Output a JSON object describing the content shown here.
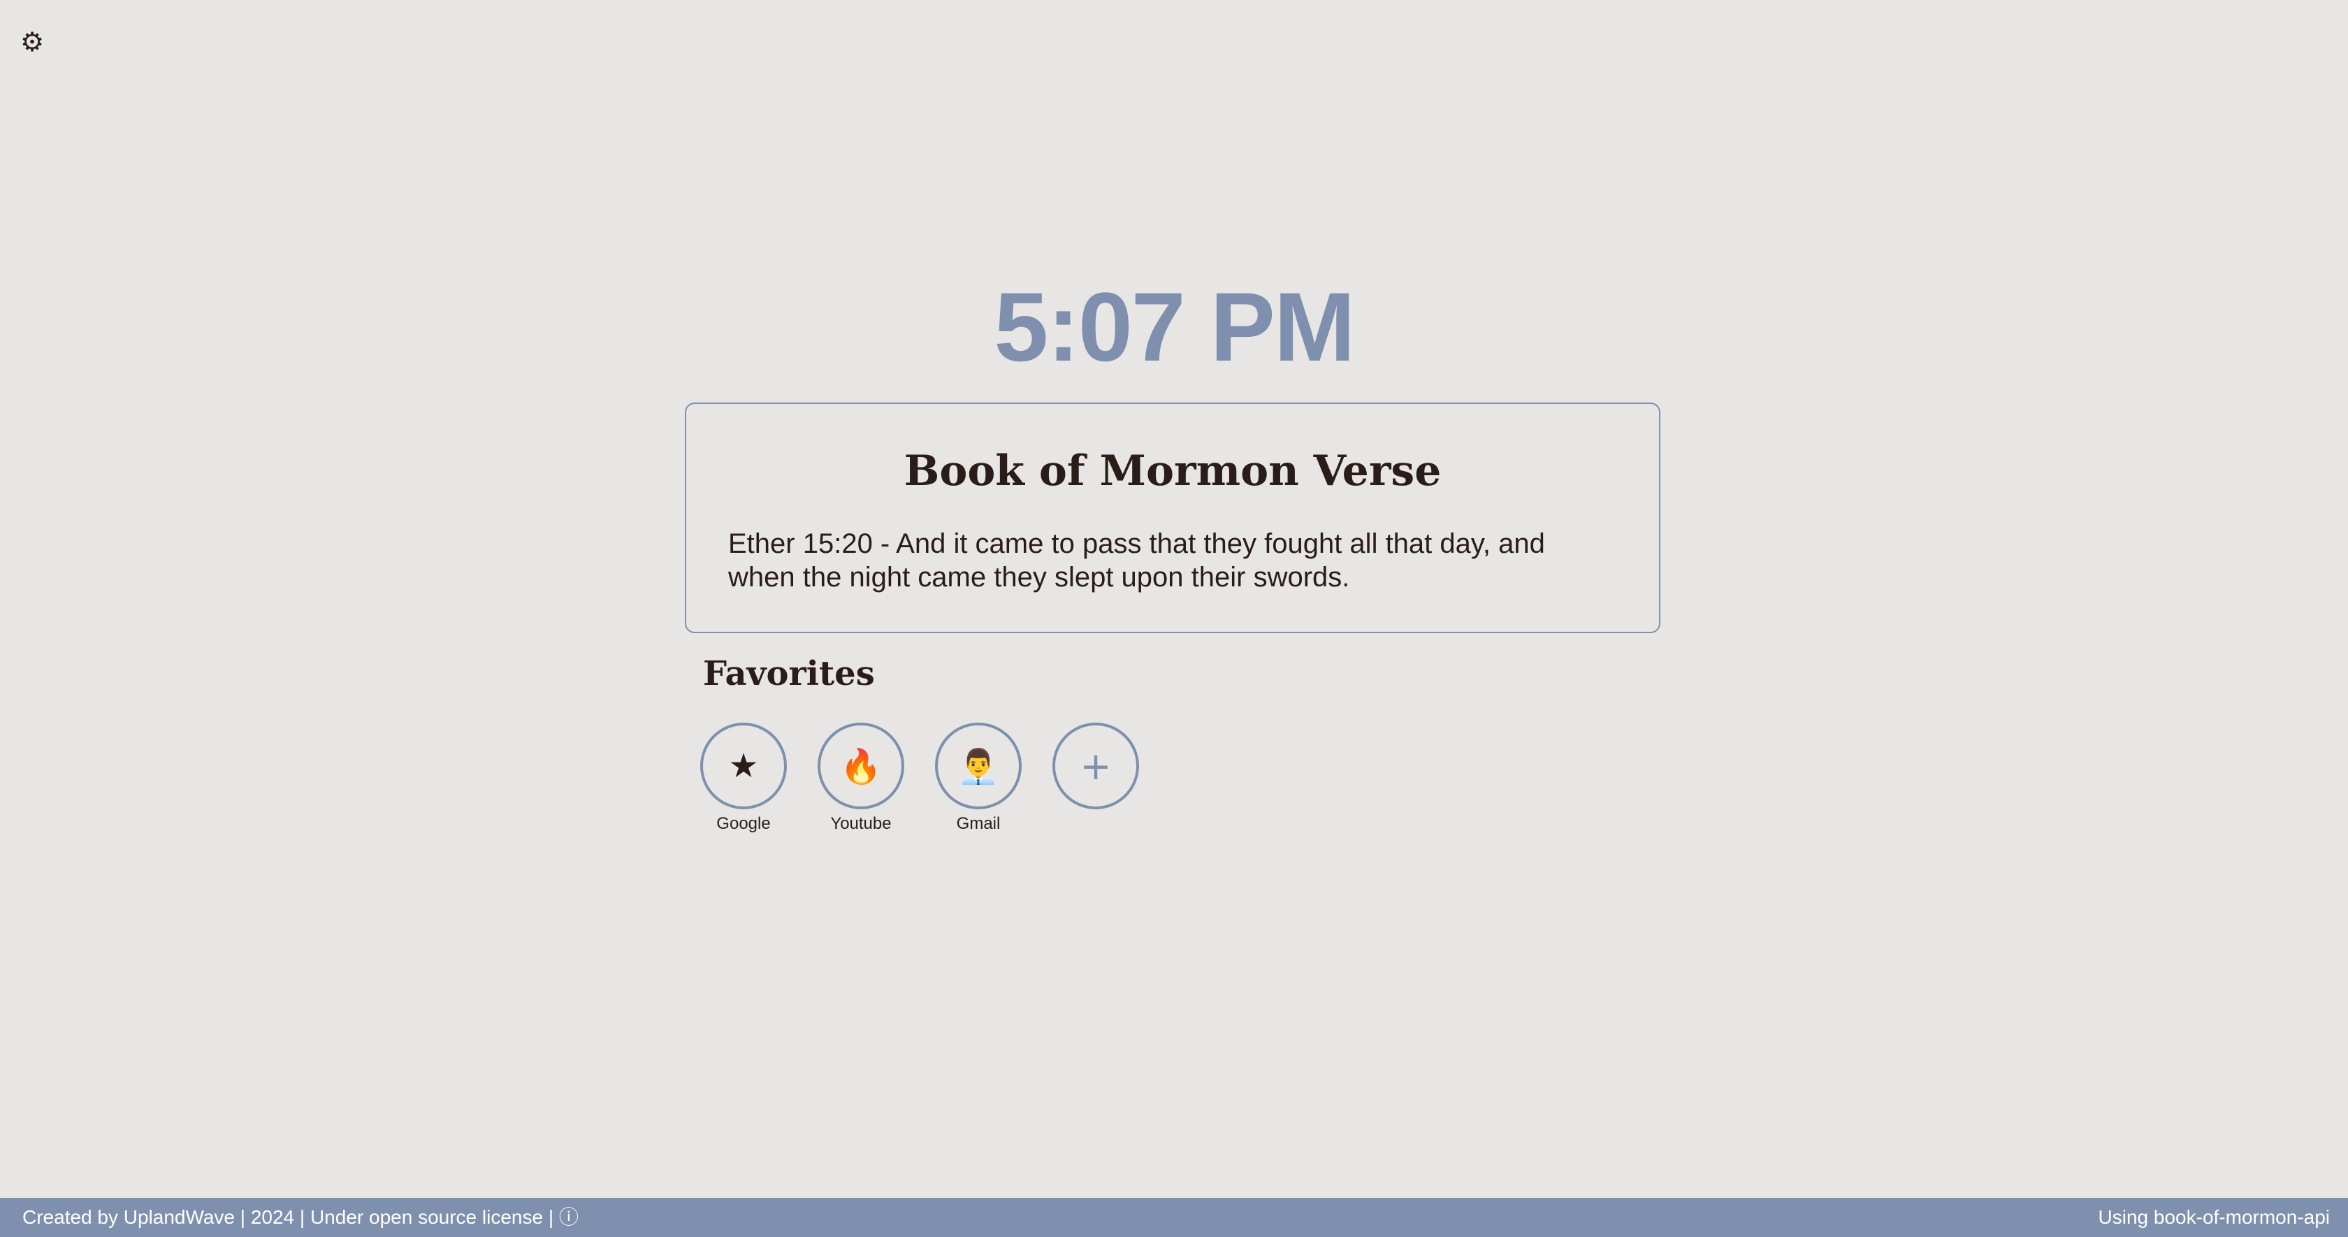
{
  "settings": {
    "icon": "gear-icon",
    "glyph": "⚙"
  },
  "clock": {
    "time": "5:07 PM"
  },
  "verse": {
    "title": "Book of Mormon Verse",
    "text": "Ether 15:20 - And it came to pass that they fought all that day, and when the night came they slept upon their swords."
  },
  "favorites": {
    "title": "Favorites",
    "items": [
      {
        "label": "Google",
        "glyph": "★",
        "icon": "star-icon"
      },
      {
        "label": "Youtube",
        "glyph": "🔥",
        "icon": "fire-icon"
      },
      {
        "label": "Gmail",
        "glyph": "👨‍💼",
        "icon": "person-icon"
      }
    ],
    "add_glyph": "+"
  },
  "footer": {
    "left_text": "Created by UplandWave | 2024 | Under open source license |",
    "info_glyph": "ⓘ",
    "right_text": "Using book-of-mormon-api"
  },
  "colors": {
    "background": "#e8e6e4",
    "accent": "#7e90ae",
    "text": "#2a1d19"
  }
}
